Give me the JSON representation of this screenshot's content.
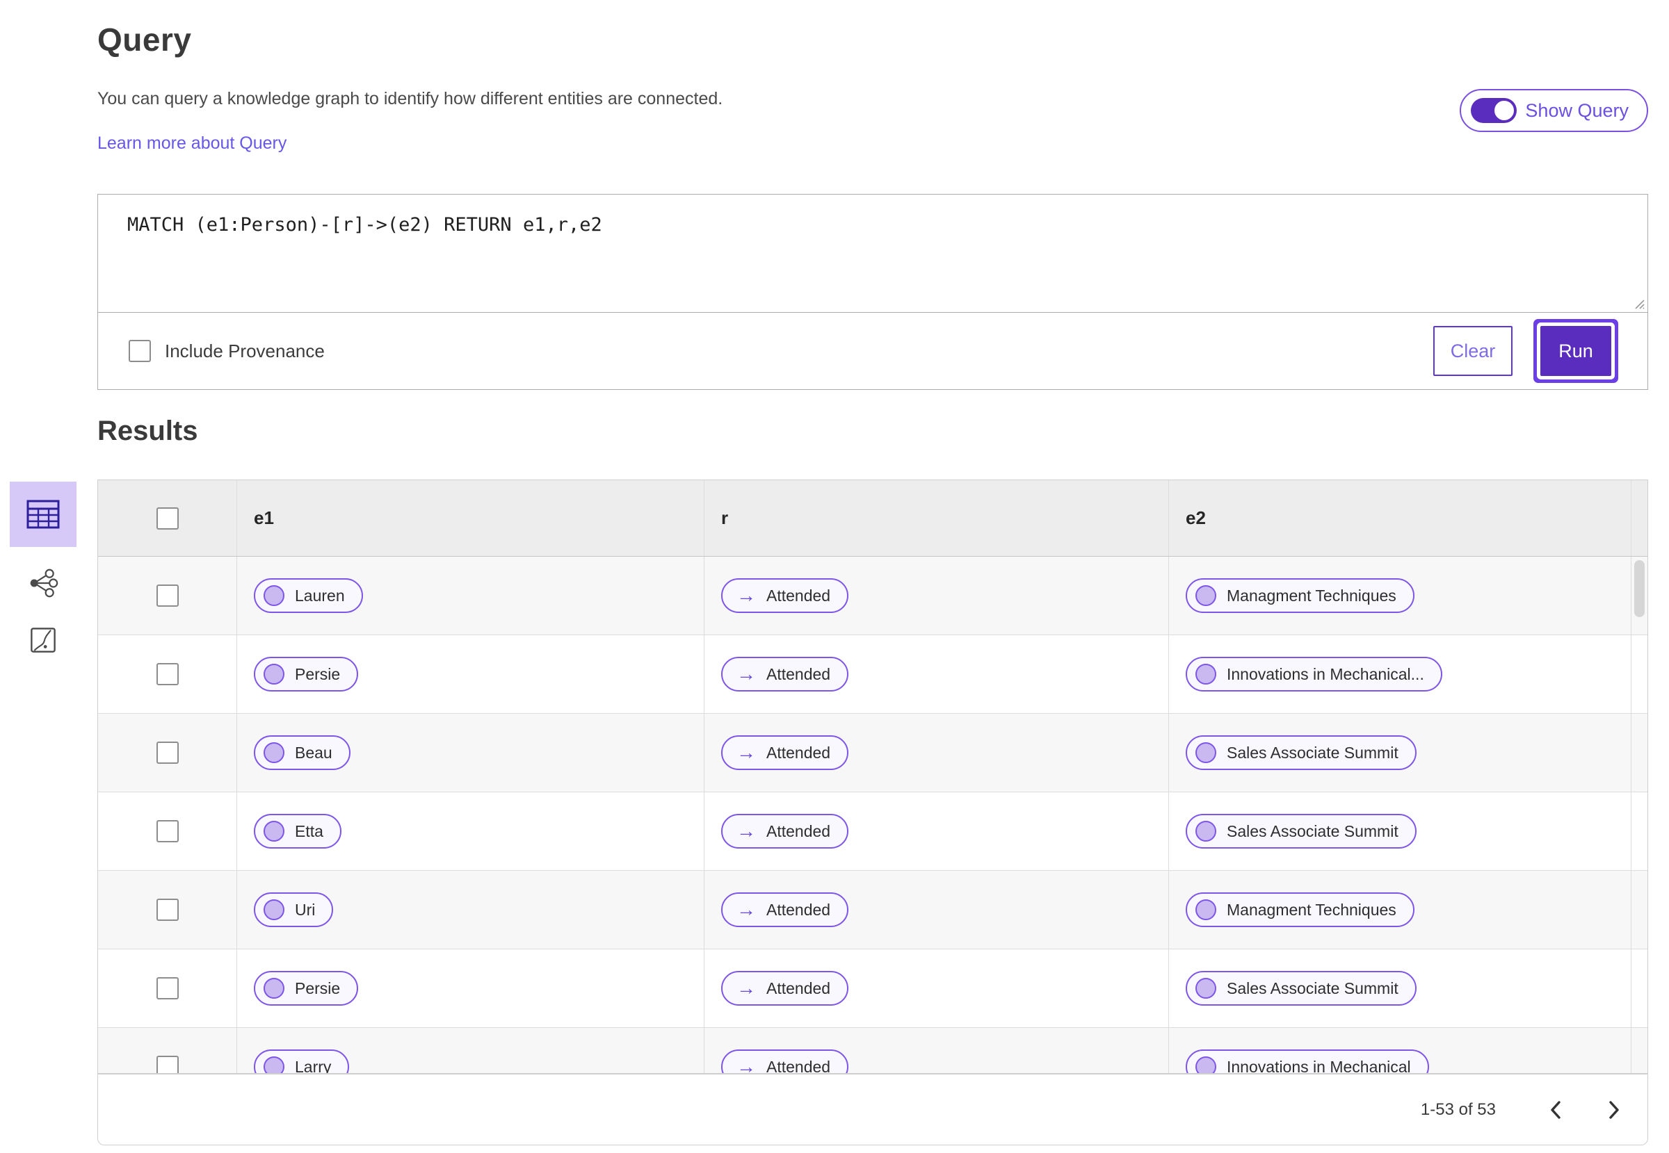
{
  "query_section": {
    "title": "Query",
    "description": "You can query a knowledge graph to identify how different entities are connected.",
    "link_label": "Learn more about Query",
    "show_query_label": "Show Query",
    "show_query_on": true,
    "query_text": "MATCH (e1:Person)-[r]->(e2) RETURN e1,r,e2",
    "include_provenance_label": "Include Provenance",
    "include_provenance_checked": false,
    "clear_label": "Clear",
    "run_label": "Run"
  },
  "results_section": {
    "title": "Results",
    "view_switcher": [
      {
        "name": "table-view",
        "active": true
      },
      {
        "name": "network-view",
        "active": false
      },
      {
        "name": "chart-view",
        "active": false
      }
    ],
    "table": {
      "columns": [
        "e1",
        "r",
        "e2"
      ],
      "rows": [
        {
          "e1": "Lauren",
          "r": "Attended",
          "e2": "Managment Techniques"
        },
        {
          "e1": "Persie",
          "r": "Attended",
          "e2": "Innovations in Mechanical..."
        },
        {
          "e1": "Beau",
          "r": "Attended",
          "e2": "Sales Associate Summit"
        },
        {
          "e1": "Etta",
          "r": "Attended",
          "e2": "Sales Associate Summit"
        },
        {
          "e1": "Uri",
          "r": "Attended",
          "e2": "Managment Techniques"
        },
        {
          "e1": "Persie",
          "r": "Attended",
          "e2": "Sales Associate Summit"
        },
        {
          "e1": "Larry",
          "r": "Attended",
          "e2": "Innovations in Mechanical"
        }
      ]
    },
    "pagination": {
      "range_label": "1-53 of 53"
    }
  },
  "icons": {
    "relation_arrow": "→"
  },
  "colors": {
    "accent_purple": "#5b2dbe",
    "pill_border": "#7d55e8",
    "pill_background": "#faf8ff",
    "node_circle_fill": "#c9b9f0",
    "link_purple": "#6657e8",
    "active_view_background": "#d7c9f7",
    "table_header_background": "#ededed",
    "row_alt_background": "#f7f7f7"
  }
}
